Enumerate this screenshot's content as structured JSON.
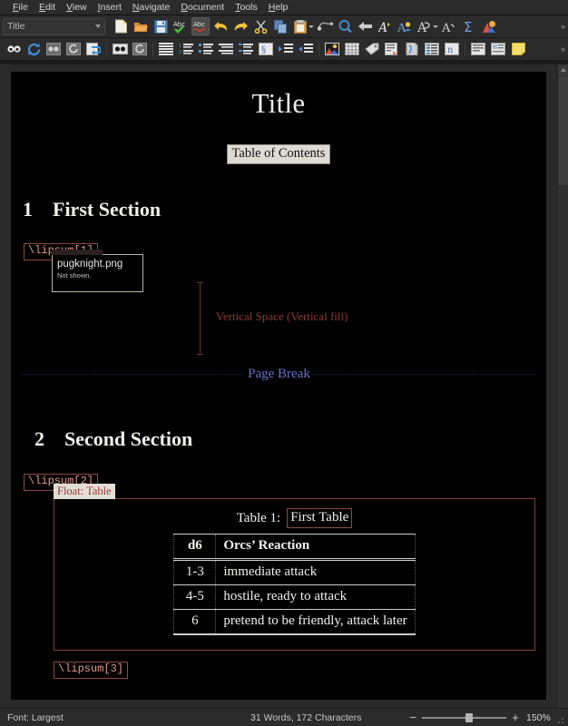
{
  "menubar": {
    "items": [
      {
        "label": "File",
        "mnemonic": "F"
      },
      {
        "label": "Edit",
        "mnemonic": "E"
      },
      {
        "label": "View",
        "mnemonic": "V"
      },
      {
        "label": "Insert",
        "mnemonic": "I"
      },
      {
        "label": "Navigate",
        "mnemonic": "N"
      },
      {
        "label": "Document",
        "mnemonic": "D"
      },
      {
        "label": "Tools",
        "mnemonic": "T"
      },
      {
        "label": "Help",
        "mnemonic": "H"
      }
    ]
  },
  "toolbar1": {
    "style_combo": {
      "value": "Title",
      "icon": "chevron-down-icon"
    },
    "buttons": [
      {
        "icon": "new-document-icon"
      },
      {
        "icon": "open-folder-icon"
      },
      {
        "icon": "save-icon"
      },
      {
        "icon": "spellcheck-icon"
      },
      {
        "icon": "spellcheck-toggle-icon",
        "pressed": true
      },
      {
        "icon": "undo-icon"
      },
      {
        "icon": "redo-icon"
      },
      {
        "icon": "cut-icon"
      },
      {
        "icon": "copy-icon"
      },
      {
        "icon": "paste-icon",
        "dropdown": true
      },
      {
        "icon": "find-replace-icon"
      },
      {
        "icon": "find-icon"
      },
      {
        "icon": "back-arrow-icon"
      },
      {
        "icon": "emphasize-icon"
      },
      {
        "icon": "noun-icon"
      },
      {
        "icon": "text-style-icon",
        "dropdown": true
      },
      {
        "icon": "verbatim-icon"
      },
      {
        "icon": "math-sigma-icon"
      },
      {
        "icon": "graphics-icon"
      }
    ],
    "overflow": "»"
  },
  "toolbar2": {
    "buttons": [
      {
        "icon": "view-source-icon"
      },
      {
        "icon": "refresh-icon"
      },
      {
        "icon": "view-master-icon"
      },
      {
        "icon": "update-other-icon"
      },
      {
        "icon": "view-other-icon"
      },
      {
        "icon": "compile-icon"
      },
      {
        "icon": "view-dvi-icon"
      },
      {
        "icon": "standard-list-icon"
      },
      {
        "icon": "numbered-list-icon"
      },
      {
        "icon": "itemized-list-icon"
      },
      {
        "icon": "description-list-icon"
      },
      {
        "icon": "labeling-list-icon"
      },
      {
        "icon": "paragraph-style-icon"
      },
      {
        "icon": "increase-depth-icon"
      },
      {
        "icon": "decrease-depth-icon"
      },
      {
        "icon": "insert-graphics-icon"
      },
      {
        "icon": "insert-table-icon"
      },
      {
        "icon": "insert-label-icon"
      },
      {
        "icon": "insert-footnote-icon"
      },
      {
        "icon": "insert-marginnote-icon"
      },
      {
        "icon": "insert-toc-icon"
      },
      {
        "icon": "insert-nomencl-icon"
      },
      {
        "icon": "insert-float-icon"
      },
      {
        "icon": "insert-wrapfloat-icon"
      },
      {
        "icon": "insert-note-icon"
      }
    ],
    "overflow": "»"
  },
  "document": {
    "title": "Title",
    "toc_label": "Table of Contents",
    "section1": {
      "number": "1",
      "heading": "First Section"
    },
    "lipsum1": "\\lipsum[1]",
    "image_box": {
      "filename": "pugknight.png",
      "note": "Not shown."
    },
    "vspace_label": "Vertical Space (Vertical fill)",
    "page_break_label": "Page Break",
    "section2": {
      "number": "2",
      "heading": "Second Section"
    },
    "lipsum2": "\\lipsum[2]",
    "float_label": "Float: Table",
    "caption": {
      "prefix": "Table 1:",
      "text": "First Table"
    },
    "table": {
      "headers": [
        "d6",
        "Orcs’ Reaction"
      ],
      "rows": [
        [
          "1-3",
          "immediate attack"
        ],
        [
          "4-5",
          "hostile, ready to attack"
        ],
        [
          "6",
          "pretend to be friendly, attack later"
        ]
      ]
    },
    "lipsum3": "\\lipsum[3]"
  },
  "statusbar": {
    "font_status": "Font: Largest",
    "word_count": "31 Words, 172 Characters",
    "zoom_out_label": "−",
    "zoom_in_label": "+",
    "zoom_level": "150%"
  },
  "colors": {
    "chrome": "#2b2b2b",
    "page": "#000000",
    "lipsum_text": "#e49b8c",
    "lipsum_border": "#8a4a42",
    "inset_label": "#9b3b33",
    "page_break": "#6b72c8",
    "vspace": "#8b3b36",
    "toc_bg": "#dedbd2"
  }
}
